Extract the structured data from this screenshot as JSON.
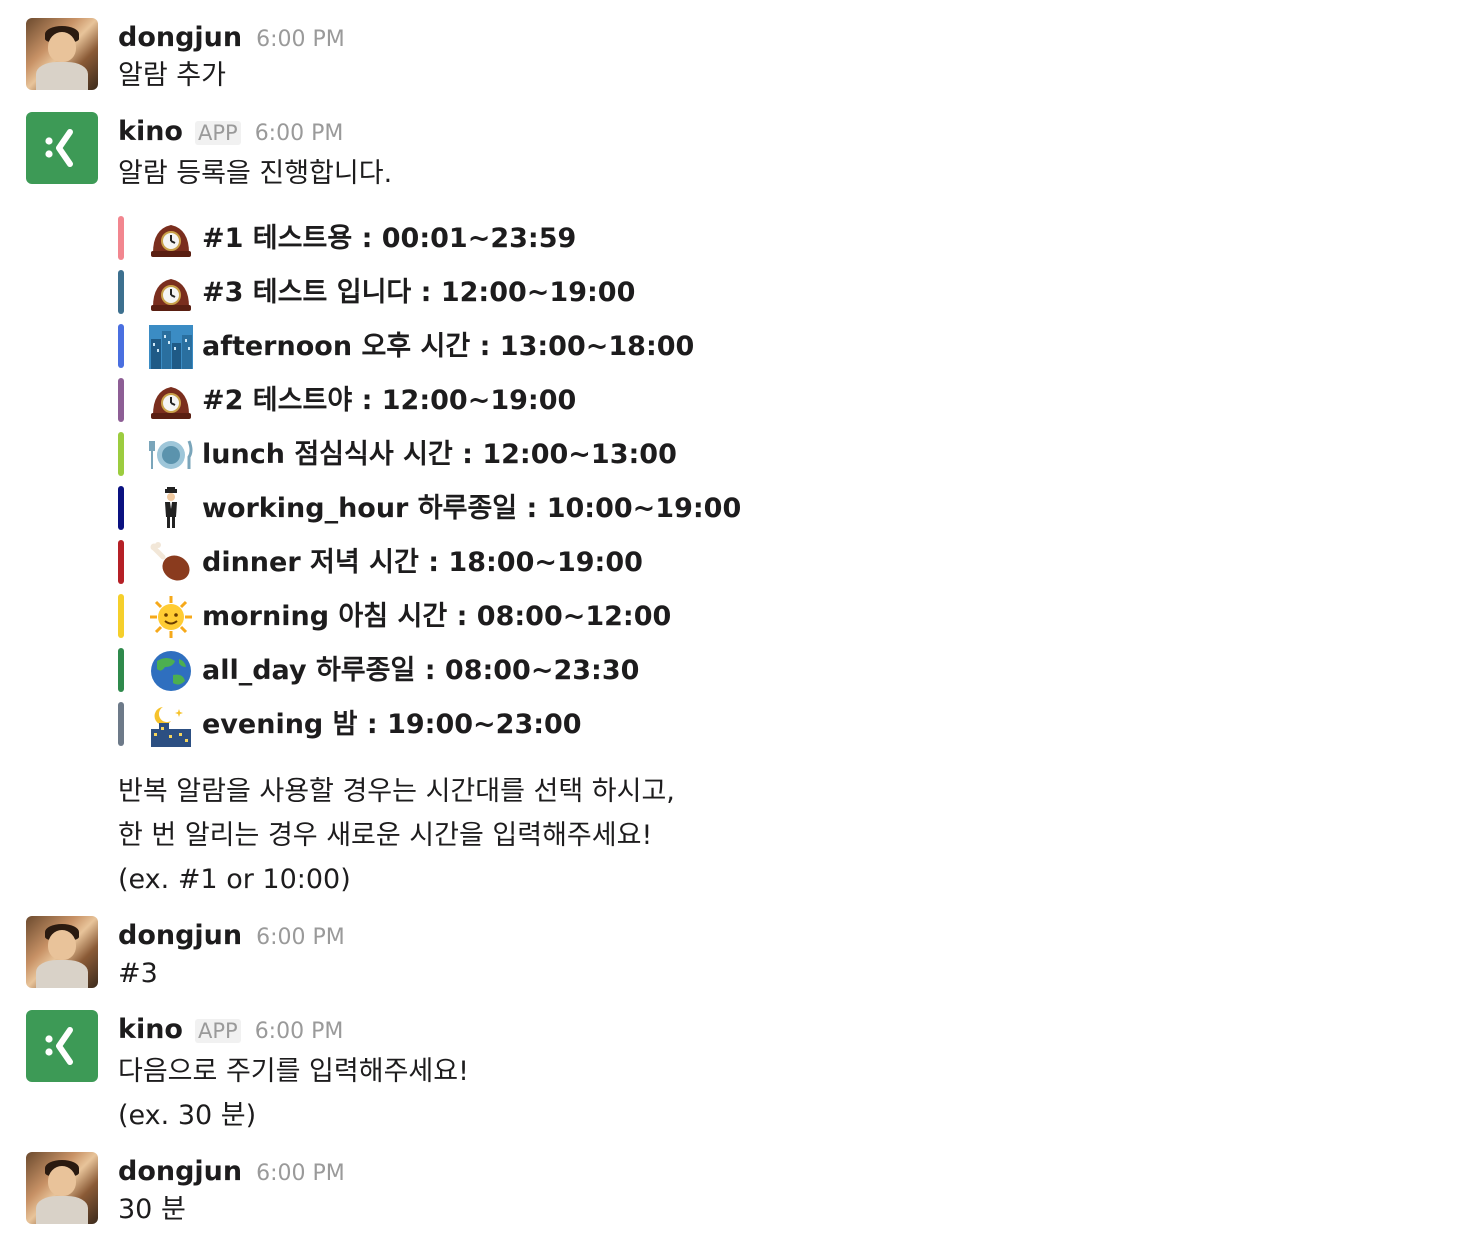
{
  "messages": [
    {
      "name": "dongjun",
      "time": "6:00 PM",
      "lines": [
        "알람 추가"
      ]
    },
    {
      "name": "kino",
      "app_badge": "APP",
      "time": "6:00 PM",
      "lines": [
        "알람 등록을 진행합니다."
      ]
    },
    {
      "name": "dongjun",
      "time": "6:00 PM",
      "lines": [
        "#3"
      ]
    },
    {
      "name": "kino",
      "app_badge": "APP",
      "time": "6:00 PM",
      "lines": [
        "다음으로 주기를 입력해주세요!",
        "(ex. 30 분)"
      ]
    },
    {
      "name": "dongjun",
      "time": "6:00 PM",
      "lines": [
        "30 분"
      ]
    }
  ],
  "alarms": [
    {
      "icon": "mantelpiece-clock-icon",
      "color": "#f2868f",
      "label": "#1 테스트용 : 00:01~23:59"
    },
    {
      "icon": "mantelpiece-clock-icon",
      "color": "#3d708f",
      "label": "#3 테스트 입니다 : 12:00~19:00"
    },
    {
      "icon": "cityscape-icon",
      "color": "#4a6fe0",
      "label": "afternoon 오후 시간 : 13:00~18:00"
    },
    {
      "icon": "mantelpiece-clock-icon",
      "color": "#8d5e95",
      "label": "#2 테스트야 : 12:00~19:00"
    },
    {
      "icon": "fork-knife-plate-icon",
      "color": "#9ccc3f",
      "label": "lunch 점심식사 시간 : 12:00~13:00"
    },
    {
      "icon": "levitating-man-icon",
      "color": "#0a1180",
      "label": "working_hour 하루종일 : 10:00~19:00"
    },
    {
      "icon": "poultry-leg-icon",
      "color": "#b52026",
      "label": "dinner 저녁 시간 : 18:00~19:00"
    },
    {
      "icon": "sun-with-face-icon",
      "color": "#f5cf2b",
      "label": "morning 아침 시간 : 08:00~12:00"
    },
    {
      "icon": "globe-asia-australia-icon",
      "color": "#2f8a4c",
      "label": "all_day 하루종일 : 08:00~23:30"
    },
    {
      "icon": "night-with-stars-icon",
      "color": "#6d7a89",
      "label": "evening 밤 : 19:00~23:00"
    }
  ],
  "instructions": [
    "반복 알람을 사용할 경우는 시간대를 선택 하시고,",
    "한 번 알리는 경우 새로운 시간을 입력해주세요!",
    "(ex. #1 or 10:00)"
  ],
  "colors": {
    "app_avatar": "#3d9a56",
    "meta_gray": "#9a9a9a",
    "text": "#1d1c1d"
  }
}
